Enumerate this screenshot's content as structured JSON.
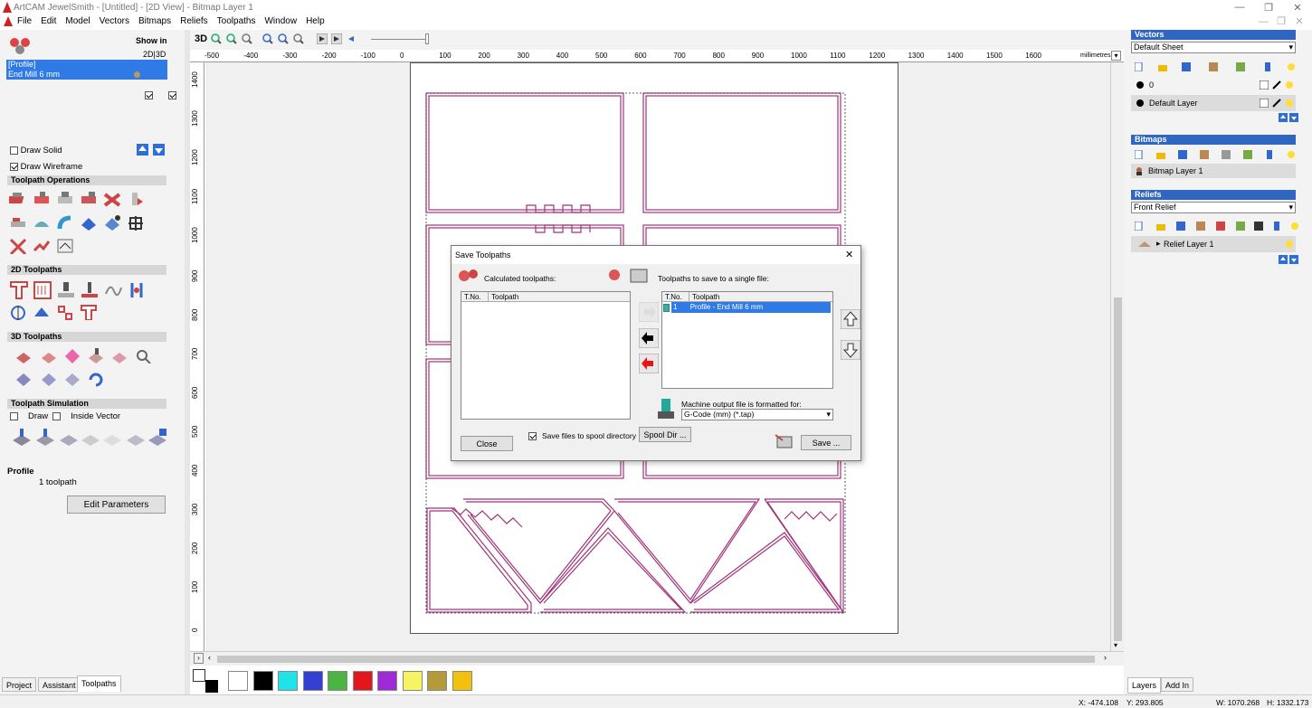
{
  "window": {
    "title": "ArtCAM JewelSmith - [Untitled] - [2D View] - Bitmap Layer 1",
    "minimize": "—",
    "restore": "❐",
    "close": "✕",
    "inner_min": "—",
    "inner_restore": "❐",
    "inner_close": "✕"
  },
  "menu": [
    "File",
    "Edit",
    "Model",
    "Vectors",
    "Bitmaps",
    "Reliefs",
    "Toolpaths",
    "Window",
    "Help"
  ],
  "left": {
    "show_in": "Show in",
    "view_2d3d": "2D|3D",
    "tp_group": "[Profile]",
    "tp_item": "End Mill 6 mm",
    "draw_solid": "Draw Solid",
    "draw_wireframe": "Draw Wireframe",
    "sec_ops": "Toolpath Operations",
    "sec_2d": "2D Toolpaths",
    "sec_3d": "3D Toolpaths",
    "sec_sim": "Toolpath Simulation",
    "sim_draw": "Draw",
    "sim_inside": "Inside Vector",
    "profile_title": "Profile",
    "profile_count": "1 toolpath",
    "edit_params": "Edit Parameters",
    "tabs": [
      "Project",
      "Assistant",
      "Toolpaths"
    ]
  },
  "view": {
    "label_3d": "3D",
    "units": "millimetres",
    "ruler_x": [
      "-500",
      "-400",
      "-300",
      "-200",
      "-100",
      "0",
      "100",
      "200",
      "300",
      "400",
      "500",
      "600",
      "700",
      "800",
      "900",
      "1000",
      "1100",
      "1200",
      "1300",
      "1400",
      "1500",
      "1600"
    ],
    "ruler_y": [
      "1400",
      "1300",
      "1200",
      "1100",
      "1000",
      "900",
      "800",
      "700",
      "600",
      "500",
      "400",
      "300",
      "200",
      "100",
      "0"
    ]
  },
  "dialog": {
    "title": "Save Toolpaths",
    "close": "✕",
    "calc_label": "Calculated toolpaths:",
    "save_label": "Toolpaths to save to a single file:",
    "col_tno": "T.No.",
    "col_toolpath": "Toolpath",
    "selected_tno": "1",
    "selected_name": "Profile - End Mill 6 mm",
    "machine_label": "Machine output file is formatted for:",
    "machine_value": "G-Code (mm) (*.tap)",
    "spool_checkbox": "Save files to spool directory",
    "spool_dir": "Spool Dir ...",
    "close_btn": "Close",
    "save_btn": "Save ..."
  },
  "right": {
    "vectors": "Vectors",
    "default_sheet": "Default Sheet",
    "layer0": "0",
    "default_layer": "Default Layer",
    "bitmaps": "Bitmaps",
    "bitmap_layer": "Bitmap Layer 1",
    "reliefs": "Reliefs",
    "front_relief": "Front Relief",
    "relief_layer": "Relief Layer 1",
    "tabs": [
      "Layers",
      "Add In"
    ]
  },
  "status": {
    "x": "X: -474.108",
    "y": "Y: 293.805",
    "w": "W: 1070.268",
    "h": "H: 1332.173"
  },
  "palette": [
    "#ffffff",
    "#000000",
    "#1fe3e9",
    "#3540d3",
    "#4bb543",
    "#e3161d",
    "#9c2bd6",
    "#f6f464",
    "#b49a3a",
    "#f4c00f"
  ]
}
